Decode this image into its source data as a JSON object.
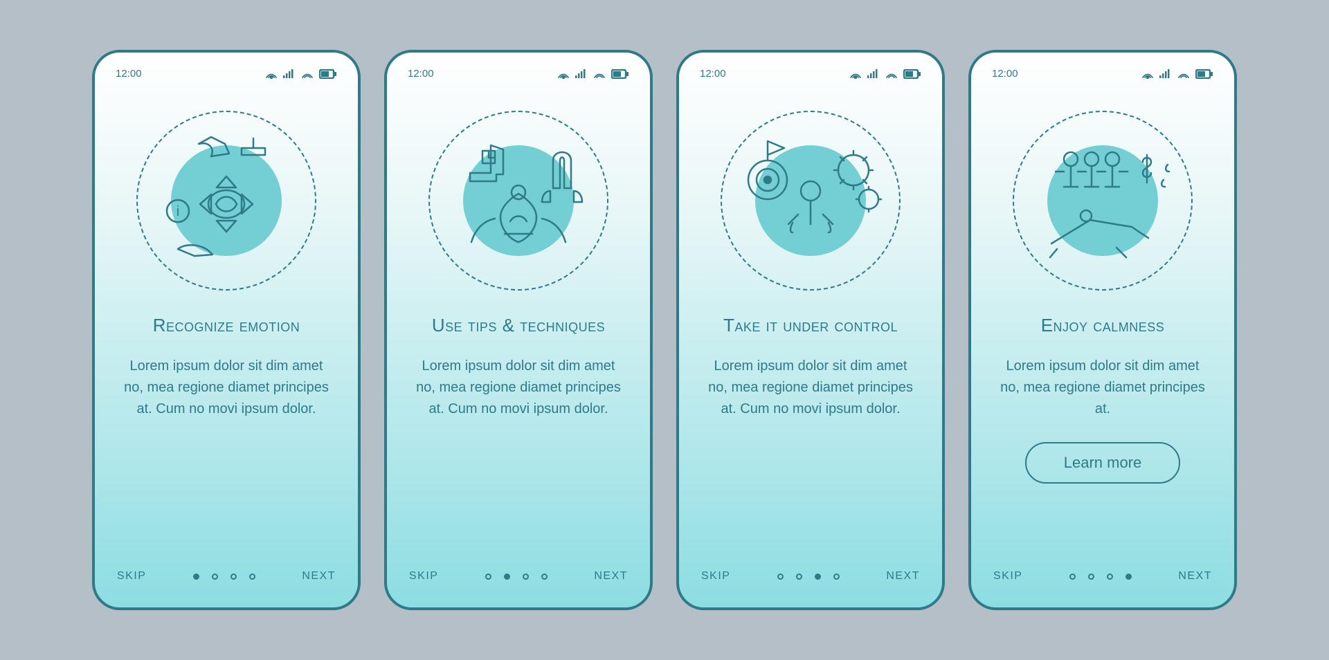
{
  "statusbar": {
    "time": "12:00"
  },
  "footer": {
    "skip": "SKIP",
    "next": "NEXT"
  },
  "screens": [
    {
      "title": "Recognize emotion",
      "desc": "Lorem ipsum dolor sit dim amet no, mea regione diamet principes at. Cum no movi ipsum dolor.",
      "active_dot": 0,
      "cta": null,
      "icon": "emotion"
    },
    {
      "title": "Use tips & techniques",
      "desc": "Lorem ipsum dolor sit dim amet no, mea regione diamet principes at. Cum no movi ipsum dolor.",
      "active_dot": 1,
      "cta": null,
      "icon": "tips"
    },
    {
      "title": "Take it under control",
      "desc": "Lorem ipsum dolor sit dim amet no, mea regione diamet principes at. Cum no movi ipsum dolor.",
      "active_dot": 2,
      "cta": null,
      "icon": "control"
    },
    {
      "title": "Enjoy calmness",
      "desc": "Lorem ipsum dolor sit dim amet no, mea regione diamet principes at.",
      "active_dot": 3,
      "cta": "Learn more",
      "icon": "calm"
    }
  ]
}
